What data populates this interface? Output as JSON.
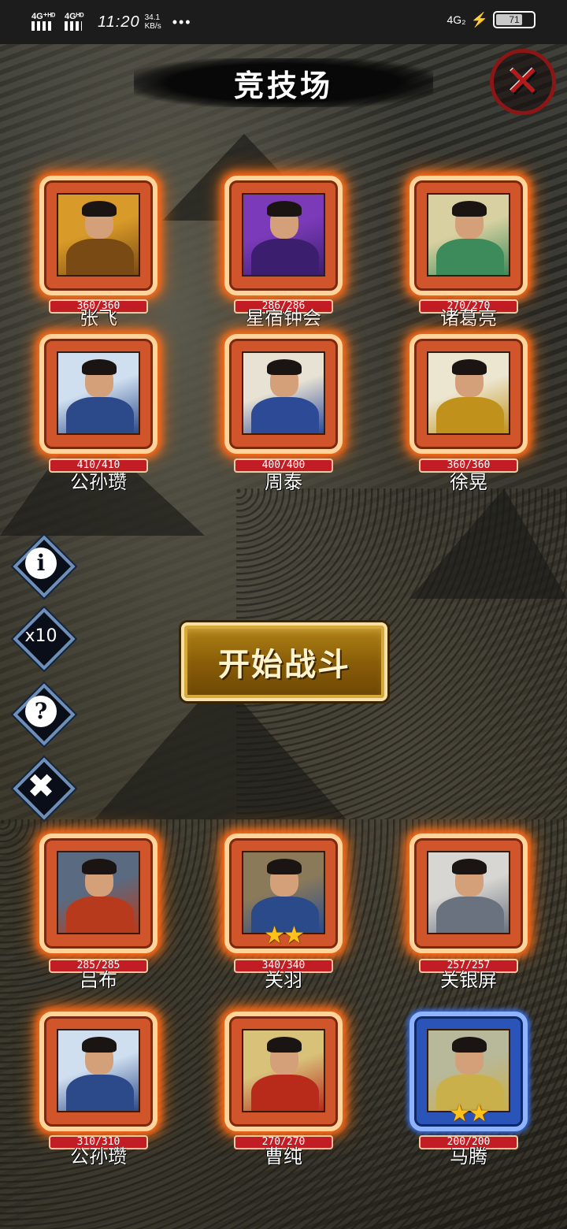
{
  "status_bar": {
    "network_1": "4G⁺ᴴᴰ",
    "network_2": "4Gᴴᴰ",
    "time": "11:20",
    "speed_value": "34.1",
    "speed_unit": "KB/s",
    "dots": "•••",
    "network_right": "4G₂",
    "charging_icon": "bolt-icon",
    "battery": "71",
    "battery_level": 0.71
  },
  "title": "竞技场",
  "close_label": "✕",
  "side_buttons": [
    {
      "id": "info",
      "label": "i"
    },
    {
      "id": "speed",
      "label": "x10"
    },
    {
      "id": "help",
      "label": "?"
    },
    {
      "id": "close",
      "label": "✖"
    }
  ],
  "start_button": "开始战斗",
  "enemy_team": [
    {
      "name": "张飞",
      "hp": "360/360",
      "stars": 0,
      "frame": "orange",
      "art": [
        "#d89a28",
        "#7a4a14"
      ]
    },
    {
      "name": "星宿钟会",
      "hp": "286/286",
      "stars": 0,
      "frame": "orange",
      "art": [
        "#7b3ab8",
        "#3b1f6e"
      ]
    },
    {
      "name": "诸葛亮",
      "hp": "270/270",
      "stars": 0,
      "frame": "orange",
      "art": [
        "#d8d0a0",
        "#3d8a5a"
      ]
    },
    {
      "name": "公孙瓒",
      "hp": "410/410",
      "stars": 0,
      "frame": "orange",
      "art": [
        "#cfdff0",
        "#2c4a8a"
      ]
    },
    {
      "name": "周泰",
      "hp": "400/400",
      "stars": 0,
      "frame": "orange",
      "art": [
        "#e8e2d4",
        "#2c4a96"
      ]
    },
    {
      "name": "徐晃",
      "hp": "360/360",
      "stars": 0,
      "frame": "orange",
      "art": [
        "#ece6d0",
        "#c0921c"
      ]
    }
  ],
  "player_team": [
    {
      "name": "吕布",
      "hp": "285/285",
      "stars": 0,
      "frame": "orange",
      "art": [
        "#5a6a80",
        "#b83a1c"
      ]
    },
    {
      "name": "关羽",
      "hp": "340/340",
      "stars": 2,
      "frame": "orange",
      "art": [
        "#8a7a5a",
        "#2a4a8a"
      ]
    },
    {
      "name": "关银屏",
      "hp": "257/257",
      "stars": 0,
      "frame": "orange",
      "art": [
        "#d8d6d2",
        "#6a7280"
      ]
    },
    {
      "name": "公孙瓒",
      "hp": "310/310",
      "stars": 0,
      "frame": "orange",
      "art": [
        "#cfdff0",
        "#2c4a8a"
      ]
    },
    {
      "name": "曹纯",
      "hp": "270/270",
      "stars": 0,
      "frame": "orange",
      "art": [
        "#d8c27a",
        "#b82a1a"
      ]
    },
    {
      "name": "马腾",
      "hp": "200/200",
      "stars": 2,
      "frame": "blue",
      "art": [
        "#b8b89a",
        "#c9b04a"
      ]
    }
  ],
  "star_glyph": "★"
}
